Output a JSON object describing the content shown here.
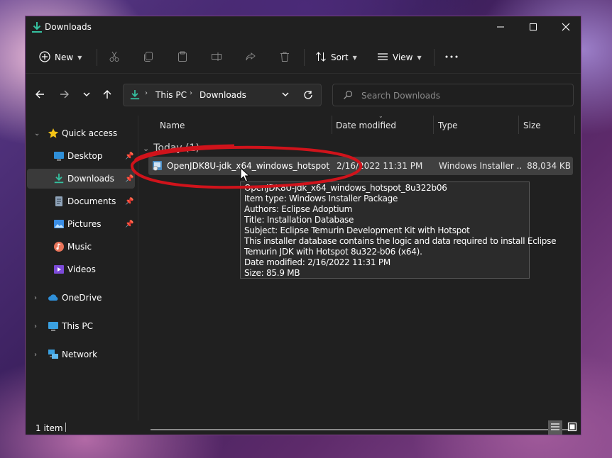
{
  "window": {
    "title": "Downloads",
    "controls": {
      "minimize": "minimize-icon",
      "maximize": "maximize-icon",
      "close": "close-icon"
    }
  },
  "toolbar": {
    "new_label": "New",
    "sort_label": "Sort",
    "view_label": "View",
    "icons": [
      "plus-icon",
      "cut-icon",
      "copy-icon",
      "paste-icon",
      "rename-icon",
      "share-icon",
      "delete-icon",
      "sort-icon",
      "view-icon",
      "more-icon"
    ]
  },
  "address_bar": {
    "breadcrumb": [
      "This PC",
      "Downloads"
    ]
  },
  "search": {
    "placeholder": "Search Downloads"
  },
  "sidebar": {
    "items": [
      {
        "label": "Quick access",
        "icon": "star-icon"
      },
      {
        "label": "Desktop",
        "icon": "desktop-icon"
      },
      {
        "label": "Downloads",
        "icon": "download-icon"
      },
      {
        "label": "Documents",
        "icon": "documents-icon"
      },
      {
        "label": "Pictures",
        "icon": "pictures-icon"
      },
      {
        "label": "Music",
        "icon": "music-icon"
      },
      {
        "label": "Videos",
        "icon": "videos-icon"
      },
      {
        "label": "OneDrive",
        "icon": "cloud-icon"
      },
      {
        "label": "This PC",
        "icon": "monitor-icon"
      },
      {
        "label": "Network",
        "icon": "network-icon"
      }
    ]
  },
  "columns": [
    "Name",
    "Date modified",
    "Type",
    "Size"
  ],
  "group": {
    "label": "Today (1)"
  },
  "files": [
    {
      "name": "OpenJDK8U-jdk_x64_windows_hotspot_8...",
      "date": "2/16/2022 11:31 PM",
      "type": "Windows Installer ...",
      "size": "88,034 KB"
    }
  ],
  "tooltip": {
    "lines": [
      "OpenJDK8U-jdk_x64_windows_hotspot_8u322b06",
      "Item type: Windows Installer Package",
      "Authors: Eclipse Adoptium",
      "Title: Installation Database",
      "Subject: Eclipse Temurin Development Kit with Hotspot",
      "This installer database contains the logic and data required to install Eclipse",
      "Temurin JDK with Hotspot 8u322-b06 (x64).",
      "Date modified: 2/16/2022 11:31 PM",
      "Size: 85.9 MB"
    ]
  },
  "status": {
    "item_count": "1 item"
  },
  "colors": {
    "accent": "#00b294",
    "window_bg": "#202020",
    "selected_row": "#404040",
    "annotation_circle": "#d0131b"
  }
}
